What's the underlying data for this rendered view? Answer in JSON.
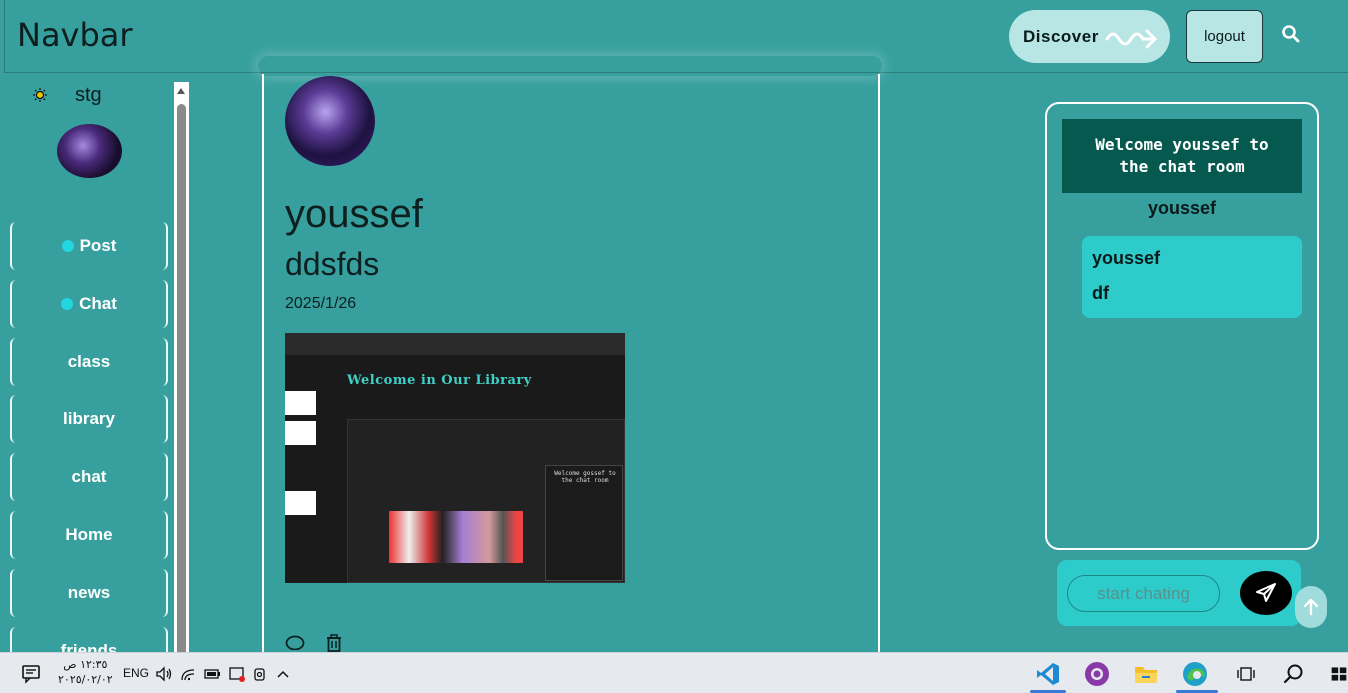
{
  "navbar": {
    "brand": "Navbar",
    "discover_label": "Discover",
    "logout_label": "logout"
  },
  "sidebar": {
    "username": "stg",
    "items": [
      {
        "label": "Post",
        "icon": "plus-circle-icon"
      },
      {
        "label": "Chat",
        "icon": "chat-bubble-icon"
      },
      {
        "label": "class"
      },
      {
        "label": "library"
      },
      {
        "label": "chat"
      },
      {
        "label": "Home"
      },
      {
        "label": "news"
      },
      {
        "label": "friends"
      }
    ]
  },
  "post": {
    "username": "youssef",
    "title": "ddsfds",
    "date": "2025/1/26",
    "image": {
      "heading": "Welcome in Our Library",
      "chat_preview": "Welcome gossef to the chat room",
      "preview_user": "gossef"
    }
  },
  "chat": {
    "welcome": "Welcome youssef to the chat room",
    "current_user": "youssef",
    "messages": [
      {
        "sender": "youssef",
        "text": "df"
      }
    ],
    "input_placeholder": "start chating"
  },
  "taskbar": {
    "time": "١٢:٣٥ ص",
    "date": "٢٠٢٥/٠٢/٠٢",
    "lang": "ENG"
  },
  "colors": {
    "page_bg": "#37a09e",
    "accent": "#2ecbcb",
    "welcome_bg": "#06594f"
  }
}
